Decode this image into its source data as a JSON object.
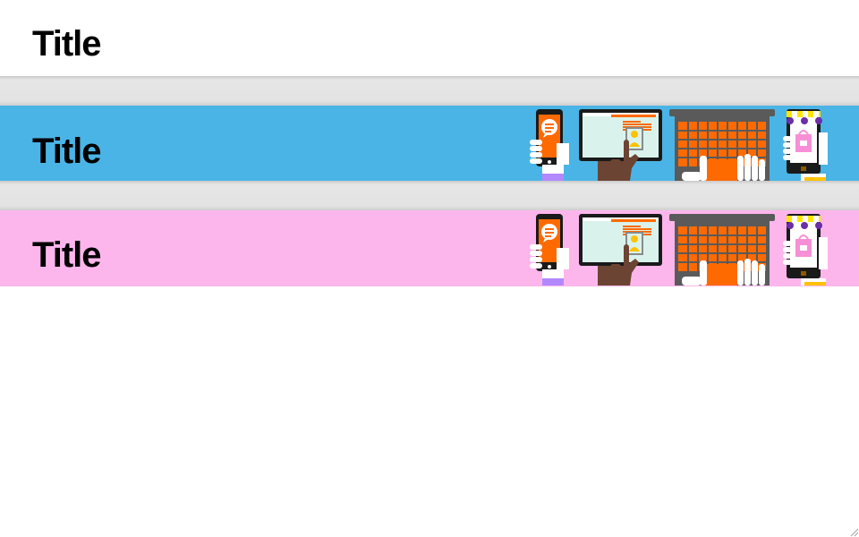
{
  "banners": [
    {
      "title": "Title",
      "background": "#ffffff",
      "illustration": false
    },
    {
      "title": "Title",
      "background": "#4ab4e6",
      "illustration": true
    },
    {
      "title": "Title",
      "background": "#fdb6ec",
      "illustration": true
    }
  ],
  "illustration": {
    "icons": [
      "phone-chat-icon",
      "touch-monitor-icon",
      "laptop-keyboard-icon",
      "phone-shop-icon"
    ],
    "colors": {
      "orange": "#ff6a00",
      "dark": "#1a1a1a",
      "laptop_gray": "#5a5a5a",
      "skin": "#6b4433",
      "awning_yellow": "#ffe600",
      "awning_purple": "#6b2fa8",
      "shop_pink": "#f78fd6",
      "screen_mint": "#d9f3ec"
    }
  }
}
